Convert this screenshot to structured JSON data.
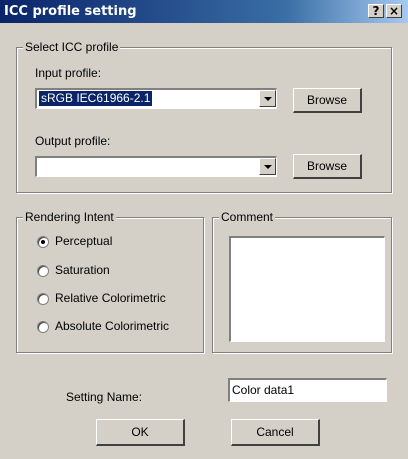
{
  "window": {
    "title": "ICC profile setting",
    "help_label": "?",
    "close_label": "×"
  },
  "select_group": {
    "legend": "Select ICC profile",
    "input_label": "Input profile:",
    "input_value": "sRGB IEC61966-2.1",
    "output_label": "Output profile:",
    "output_value": "",
    "browse_label": "Browse"
  },
  "rendering": {
    "legend": "Rendering Intent",
    "options": [
      "Perceptual",
      "Saturation",
      "Relative Colorimetric",
      "Absolute Colorimetric"
    ],
    "selected": "Perceptual"
  },
  "comment": {
    "legend": "Comment",
    "value": ""
  },
  "setting": {
    "label": "Setting Name:",
    "value": "Color data1"
  },
  "buttons": {
    "ok": "OK",
    "cancel": "Cancel"
  }
}
